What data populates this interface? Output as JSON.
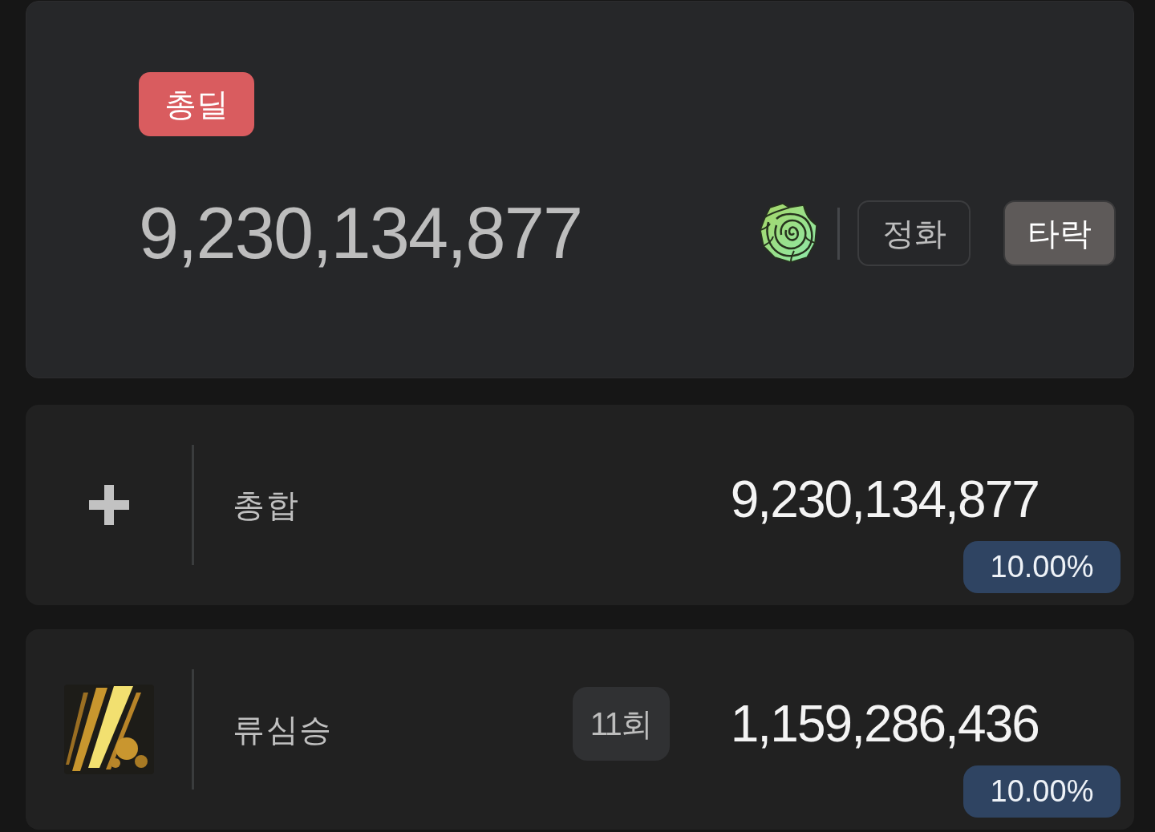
{
  "summary": {
    "badge": "총딜",
    "total": "9,230,134,877",
    "toggles": [
      {
        "label": "정화",
        "selected": false
      },
      {
        "label": "타락",
        "selected": true
      }
    ]
  },
  "rows": [
    {
      "kind": "total",
      "label": "총합",
      "value": "9,230,134,877",
      "share": "10.00%"
    },
    {
      "kind": "skill",
      "label": "류심승",
      "count": "11회",
      "value": "1,159,286,436",
      "share": "10.00%"
    }
  ]
}
